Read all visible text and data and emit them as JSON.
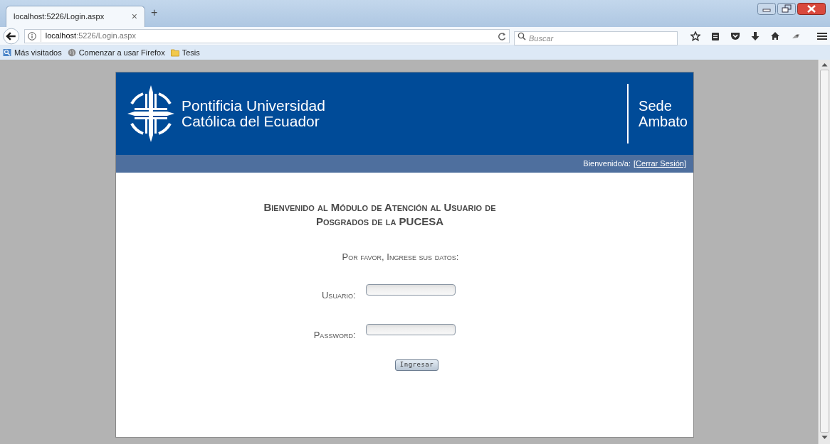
{
  "browser": {
    "tab": {
      "title": "localhost:5226/Login.aspx",
      "selected": true,
      "close": "×"
    },
    "new_tab": "+",
    "url_host": "localhost",
    "url_rest": ":5226/Login.aspx",
    "search": {
      "placeholder": "Buscar"
    },
    "bookmarks": [
      {
        "kind": "site",
        "label": "Más visitados"
      },
      {
        "kind": "globe",
        "label": "Comenzar a usar Firefox"
      },
      {
        "kind": "folder",
        "label": "Tesis"
      }
    ]
  },
  "header": {
    "university": [
      "Pontificia Universidad",
      "Católica del Ecuador"
    ],
    "campus": [
      "Sede",
      "Ambato"
    ]
  },
  "user_bar": {
    "greeting": "Bienvenido/a:",
    "link": "[Cerrar Sesión]"
  },
  "login": {
    "heading": [
      "Bienvenido al Módulo de Atención al Usuario de",
      "Posgrados de la PUCESA"
    ],
    "prompt": "Por favor, Ingrese sus datos:",
    "fields": [
      {
        "label": "Usuario:"
      },
      {
        "label": "Password:"
      }
    ],
    "button": "Ingresar"
  }
}
